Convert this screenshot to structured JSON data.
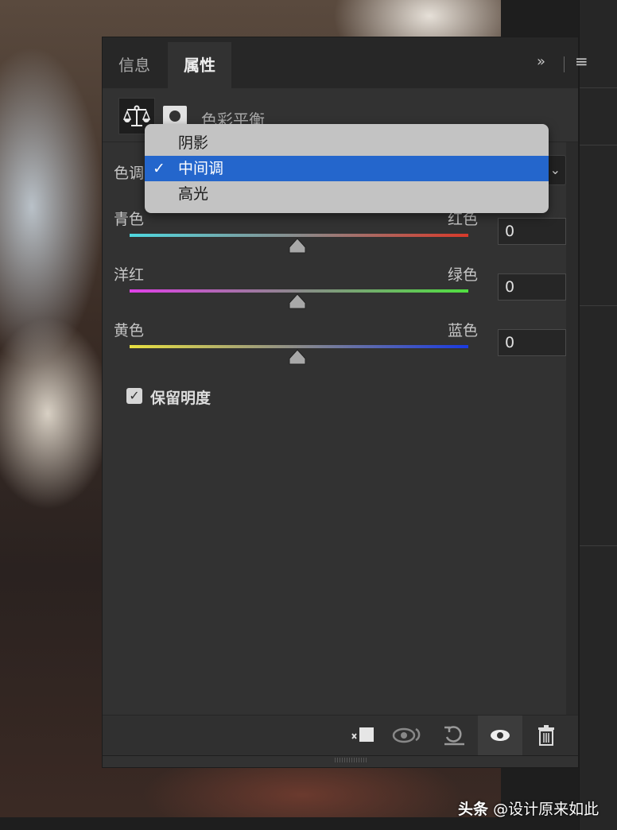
{
  "tabs": [
    {
      "label": "信息",
      "active": false
    },
    {
      "label": "属性",
      "active": true
    }
  ],
  "adjustment": {
    "title": "色彩平衡",
    "icon": "balance-scale-icon"
  },
  "tone": {
    "label": "色调",
    "options": [
      "阴影",
      "中间调",
      "高光"
    ],
    "selected": "中间调"
  },
  "sliders": [
    {
      "left": "青色",
      "right": "红色",
      "value": "0",
      "colors": [
        "#4fd8e0",
        "#d83a2a"
      ]
    },
    {
      "left": "洋红",
      "right": "绿色",
      "value": "0",
      "colors": [
        "#e040e8",
        "#50e040"
      ]
    },
    {
      "left": "黄色",
      "right": "蓝色",
      "value": "0",
      "colors": [
        "#e8e040",
        "#1a3ae0"
      ]
    }
  ],
  "preserve_luminosity": {
    "label": "保留明度",
    "checked": true
  },
  "toolbar": [
    "clip-to-layer-icon",
    "view-previous-state-icon",
    "reset-icon",
    "visibility-eye-icon",
    "trash-icon"
  ],
  "watermark": {
    "brand": "头条",
    "handle": "@设计原来如此"
  },
  "accent": "#2466cc"
}
